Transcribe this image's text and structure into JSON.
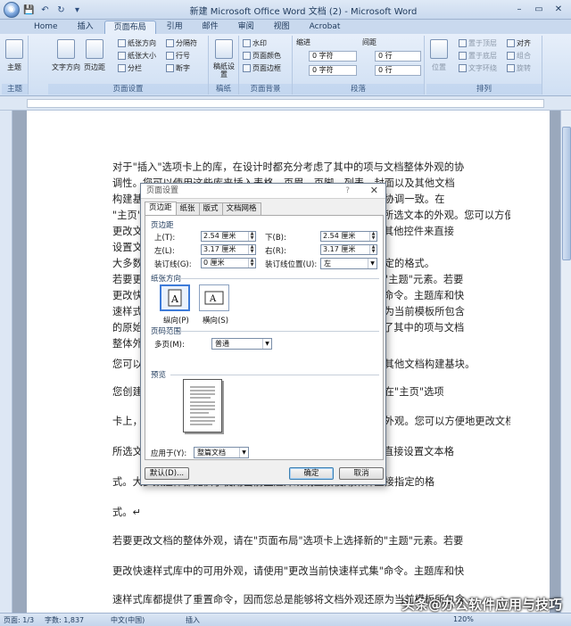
{
  "window": {
    "title": "新建 Microsoft Office Word 文档 (2) - Microsoft Word",
    "minimize": "–",
    "maximize": "▭",
    "close": "✕"
  },
  "qat": {
    "save": "💾",
    "undo": "↶",
    "redo": "↻",
    "customize": "▾"
  },
  "tabs": [
    "Home",
    "插入",
    "页面布局",
    "引用",
    "邮件",
    "审阅",
    "视图",
    "Acrobat"
  ],
  "active_tab": "页面布局",
  "ribbon": {
    "theme": {
      "label": "主题",
      "btn": "主题"
    },
    "page_setup": {
      "label": "页面设置",
      "text_direction": "文字方向",
      "margins": "页边距",
      "orientation": "纸张方向",
      "size": "纸张大小",
      "columns": "分栏",
      "breaks": "分隔符",
      "line_numbers": "行号",
      "hyphenation": "断字"
    },
    "draft": {
      "label": "稿纸",
      "btn": "稿纸设置"
    },
    "background": {
      "label": "页面背景",
      "watermark": "水印",
      "page_color": "页面颜色",
      "page_border": "页面边框"
    },
    "paragraph": {
      "label": "段落",
      "indent": "缩进",
      "spacing": "间距",
      "left_val": "0 字符",
      "right_val": "0 字符",
      "before_val": "0 行",
      "after_val": "0 行"
    },
    "arrange": {
      "label": "排列",
      "position": "位置",
      "front": "置于顶层",
      "back": "置于底层",
      "wrap": "文字环绕",
      "align": "对齐",
      "group": "组合",
      "rotate": "旋转"
    }
  },
  "document": {
    "lines": [
      "对于\"插入\"选项卡上的库，在设计时都充分考虑了其中的项与文档整体外观的协",
      "调性。您可以使用这些库来插入表格、页眉、页脚、列表、封面以及其他文档",
      "构建基块。您创建的图片、图表或关系图也将与当前文档外观协调一致。在",
      "\"主页\"选项卡上，通过选择新外观，您可以方便地更改文档中所选文本的外观。您可以方便地",
      "更改文档中所选文本的外观。您还可以使用\"开始\"选项卡上的其他控件来直接",
      "设置文本格式。",
      "大多数控件都提供了使用当前主题外观或直接使用某种直接指定的格式。",
      "若要更改文档的整体外观，请在\"页面布局\"选项卡上选择新的\"主题\"元素。若要",
      "更改快速样式库中的可用外观，请使用\"更改当前快速样式集\"命令。主题库和快",
      "速样式库都提供了重置命令，因而您总是能够将文档外观还原为当前模板所包含",
      "的原始外观。对于\"插入\"选项卡上的库，在设计时都充分考虑了其中的项与文档",
      "整体外观的协调性。",
      "您可以使用这些库来插入表格、页眉、页脚、列表、封面以及其他文档构建基块。",
      "您创建的图片、图表或关系图也将与当前文档外观协调一致。在\"主页\"选项",
      "卡上，通过选择新外观，您可以方便地更改文档中所选文本的外观。您可以方便地更改文档中",
      "所选文本的外观。您还可以使用\"开始\"选项卡上的其他控件来直接设置文本格",
      "式。大多数控件都提供了使用当前主题外观或直接使用某种直接指定的格",
      "式。↵",
      "若要更改文档的整体外观，请在\"页面布局\"选项卡上选择新的\"主题\"元素。若要",
      "更改快速样式库中的可用外观，请使用\"更改当前快速样式集\"命令。主题库和快",
      "速样式库都提供了重置命令，因而您总是能够将文档外观还原为当前模板所包含"
    ]
  },
  "dialog": {
    "title": "页面设置",
    "help": "?",
    "close": "✕",
    "tabs": [
      "页边距",
      "纸张",
      "版式",
      "文档网格"
    ],
    "margins_section": "页边距",
    "top_label": "上(T):",
    "top_val": "2.54 厘米",
    "bottom_label": "下(B):",
    "bottom_val": "2.54 厘米",
    "left_label": "左(L):",
    "left_val": "3.17 厘米",
    "right_label": "右(R):",
    "right_val": "3.17 厘米",
    "gutter_label": "装订线(G):",
    "gutter_val": "0 厘米",
    "gutter_pos_label": "装订线位置(U):",
    "gutter_pos_val": "左",
    "orientation_section": "纸张方向",
    "portrait": "纵向(P)",
    "landscape": "横向(S)",
    "pages_section": "页码范围",
    "multiple_pages_label": "多页(M):",
    "multiple_pages_val": "普通",
    "preview_section": "预览",
    "apply_label": "应用于(Y):",
    "apply_val": "整篇文档",
    "default_btn": "默认(D)...",
    "ok_btn": "确定",
    "cancel_btn": "取消"
  },
  "status": {
    "page": "页面: 1/3",
    "words": "字数: 1,837",
    "lang": "中文(中国)",
    "mode": "插入",
    "zoom": "120%"
  },
  "watermark_text": "头条@办公软件应用与技巧"
}
